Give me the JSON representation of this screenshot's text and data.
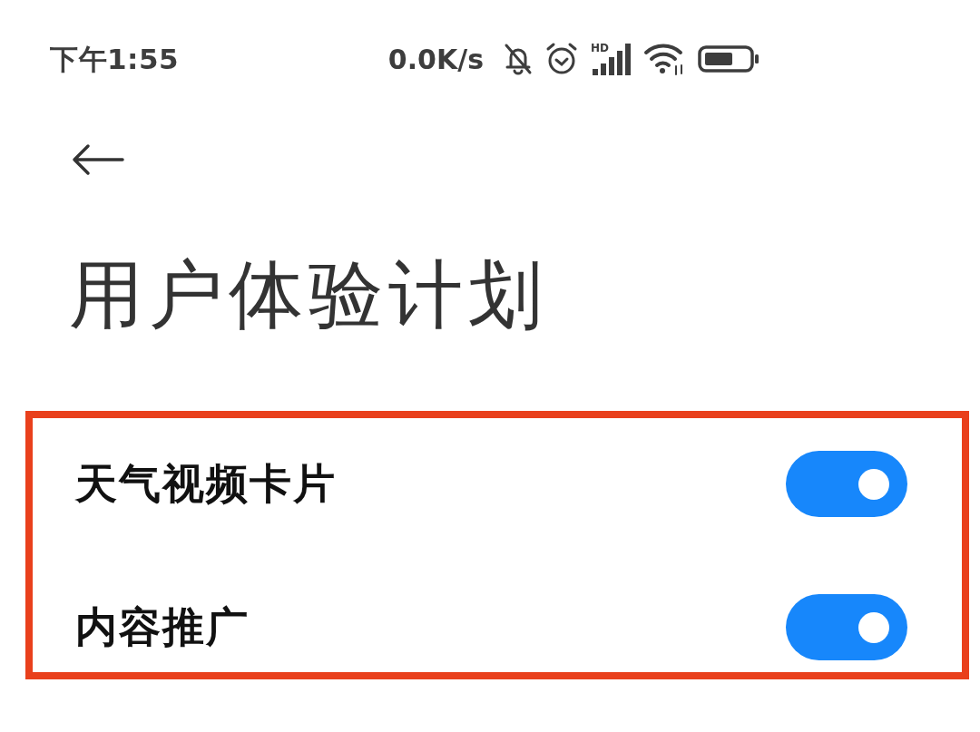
{
  "status_bar": {
    "time": "下午1:55",
    "net_speed": "0.0K/s",
    "signal_label": "HD"
  },
  "title": "用户体验计划",
  "settings": {
    "highlighted": true,
    "items": [
      {
        "label": "天气视频卡片",
        "on": true
      },
      {
        "label": "内容推广",
        "on": true
      }
    ]
  }
}
